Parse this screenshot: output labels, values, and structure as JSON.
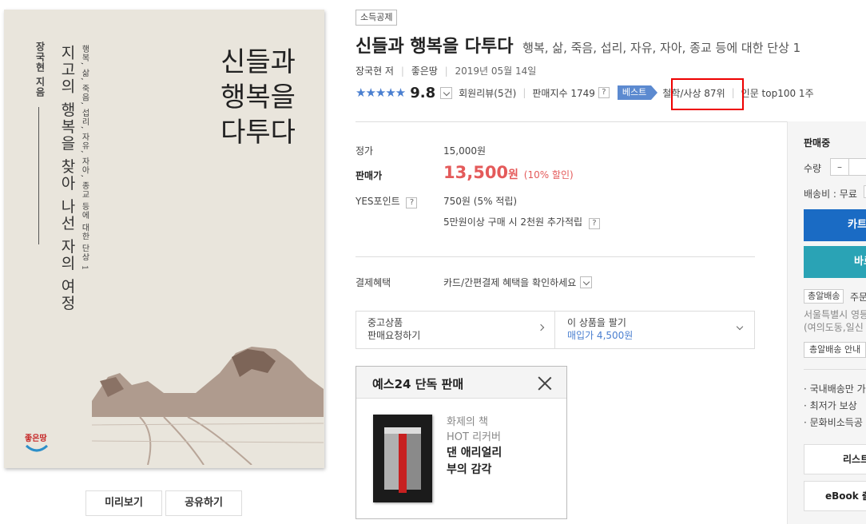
{
  "cover": {
    "spine_author": "장국현 지음",
    "subtitle": "지고의 행복을 찾아 나선 자의 여정",
    "small_text": "행복, 삶, 죽음, 섭리, 자유, 자아, 종교 등에 대한 단상 1",
    "title_lines": [
      "신들과",
      "행복을",
      "다투다"
    ],
    "publisher_logo": "좋은땅"
  },
  "buttons": {
    "preview": "미리보기",
    "share": "공유하기"
  },
  "badge": "소득공제",
  "product": {
    "title": "신들과 행복을 다투다",
    "subtitle": "행복, 삶, 죽음, 섭리, 자유, 자아, 종교 등에 대한 단상 1",
    "author": "장국현 저",
    "publisher": "좋은땅",
    "date": "2019년 05월 14일"
  },
  "rating": {
    "stars": "★★★★★",
    "score": "9.8",
    "reviews": "회원리뷰(5건)",
    "sales_index": "판매지수 1749",
    "best_label": "베스트",
    "rank1": "철학/사상 87위",
    "rank2": "인문 top100 1주",
    "help_icon": "?"
  },
  "price": {
    "list_label": "정가",
    "list_value": "15,000원",
    "sale_label": "판매가",
    "sale_price": "13,500",
    "sale_unit": "원",
    "sale_discount": "(10% 할인)",
    "point_label": "YES포인트",
    "point_value": "750원 (5% 적립)",
    "point_extra": "5만원이상 구매 시 2천원 추가적립",
    "benefit_label": "결제혜택",
    "benefit_value": "카드/간편결제 혜택을 확인하세요"
  },
  "used": {
    "left_line1": "중고상품",
    "left_line2": "판매요청하기",
    "right_line1": "이 상품을 팔기",
    "right_line2": "매입가 4,500원"
  },
  "exclusive": {
    "heading": "예스24 단독 판매",
    "line1": "화제의 책",
    "line2": "HOT 리커버",
    "line3": "댄 애리얼리",
    "line4": "부의 감각"
  },
  "side": {
    "status": "판매중",
    "qty_label": "수량",
    "minus": "–",
    "shipping": "배송비 : 무료",
    "cart": "카트",
    "buy": "바로",
    "fast_badge": "총알배송",
    "fast_text": "주문",
    "addr1": "서울특별시 영등",
    "addr2": "(여의도동,일신",
    "fast_info": "총알배송 안내",
    "bullet1": "· 국내배송만 가",
    "bullet2": "· 최저가 보상",
    "bullet3": "· 문화비소득공",
    "wishlist": "리스트",
    "ebook": "eBook 출"
  }
}
